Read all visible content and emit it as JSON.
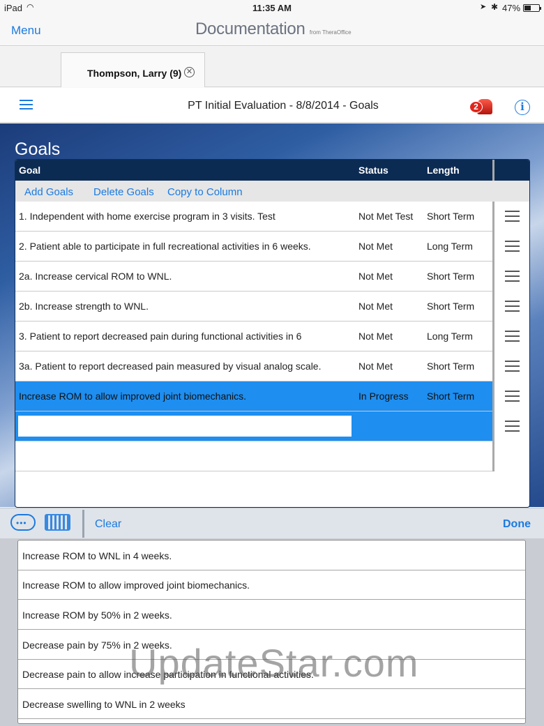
{
  "status_bar": {
    "device": "iPad",
    "time": "11:35 AM",
    "battery": "47%",
    "battery_level": 0.47
  },
  "nav": {
    "menu_label": "Menu",
    "logo_text": "Documentation",
    "logo_sub": "from TheraOffice"
  },
  "patient_tab": {
    "name": "Thompson, Larry (9)"
  },
  "form_header": {
    "title": "PT Initial Evaluation - 8/8/2014 - Goals",
    "alert_count": "2"
  },
  "section": {
    "heading": "Goals"
  },
  "table": {
    "columns": {
      "goal": "Goal",
      "status": "Status",
      "length": "Length"
    },
    "actions": {
      "add": "Add Goals",
      "delete": "Delete Goals",
      "copy": "Copy to Column"
    },
    "rows": [
      {
        "goal": "1. Independent with home exercise program in 3 visits. Test",
        "status": "Not Met Test",
        "length": "Short Term"
      },
      {
        "goal": "2. Patient able to participate in full recreational activities in 6 weeks.",
        "status": "Not Met",
        "length": "Long Term"
      },
      {
        "goal": "2a.  Increase cervical ROM to WNL.",
        "status": "Not Met",
        "length": "Short Term"
      },
      {
        "goal": "2b.  Increase strength to WNL.",
        "status": "Not Met",
        "length": "Short Term"
      },
      {
        "goal": "3.  Patient to report decreased pain during functional activities in 6",
        "status": "Not Met",
        "length": "Long Term"
      },
      {
        "goal": "3a.  Patient to report decreased pain measured by visual analog scale.",
        "status": "Not Met",
        "length": "Short Term"
      },
      {
        "goal": "Increase ROM to allow improved joint biomechanics.",
        "status": "In Progress",
        "length": "Short Term"
      }
    ]
  },
  "accessory_bar": {
    "clear_label": "Clear",
    "done_label": "Done"
  },
  "suggestions": [
    "Increase ROM to WNL in 4 weeks.",
    "Increase ROM to allow improved joint biomechanics.",
    "Increase ROM by 50% in 2 weeks.",
    "Decrease pain by 75% in 2 weeks.",
    "Decrease pain to allow increase participation in functional activities.",
    "Decrease swelling to WNL in 2 weeks"
  ],
  "watermark": "UpdateStar.com",
  "colors": {
    "accent": "#1a7ae0",
    "header_navy": "#0c2b53",
    "selected_row": "#1e8ef0"
  }
}
